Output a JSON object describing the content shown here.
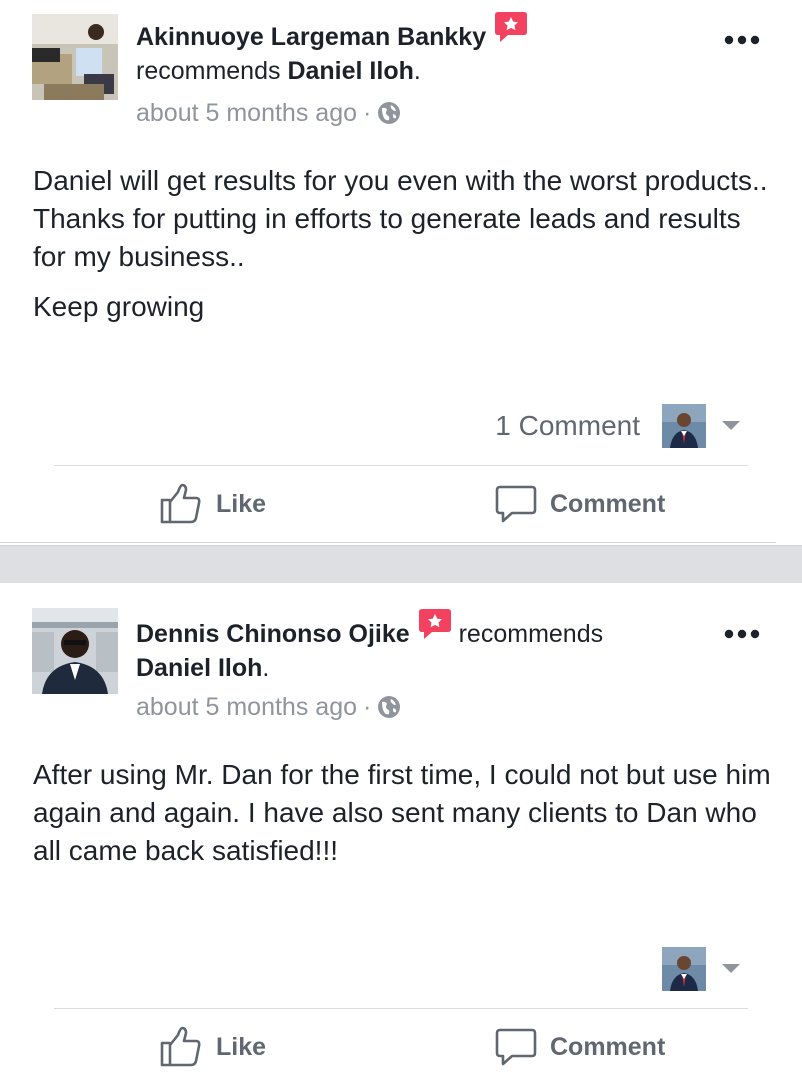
{
  "posts": [
    {
      "author": "Akinnuoye Largeman Bankky",
      "recommends_label": "recommends",
      "target": "Daniel Iloh",
      "target_suffix": ".",
      "time": "about 5 months ago",
      "separator": "·",
      "privacy_icon": "globe-icon",
      "body": [
        "Daniel will get results for you even with the worst products.. Thanks for putting in efforts to generate leads and results for my business..",
        "Keep growing"
      ],
      "comment_count": "1 Comment",
      "like_label": "Like",
      "comment_label": "Comment"
    },
    {
      "author": "Dennis Chinonso Ojike",
      "recommends_label": "recommends",
      "target": "Daniel Iloh",
      "target_suffix": ".",
      "time": "about 5 months ago",
      "separator": "·",
      "privacy_icon": "globe-icon",
      "body": [
        "After using Mr. Dan for the first time, I could not but use him again and again. I have also sent many clients to Dan who all came back satisfied!!!"
      ],
      "comment_count": "",
      "like_label": "Like",
      "comment_label": "Comment"
    }
  ],
  "colors": {
    "text": "#1d2129",
    "muted": "#90949c",
    "action": "#606770",
    "badge": "#f3425f",
    "separator": "#dddfe2"
  }
}
